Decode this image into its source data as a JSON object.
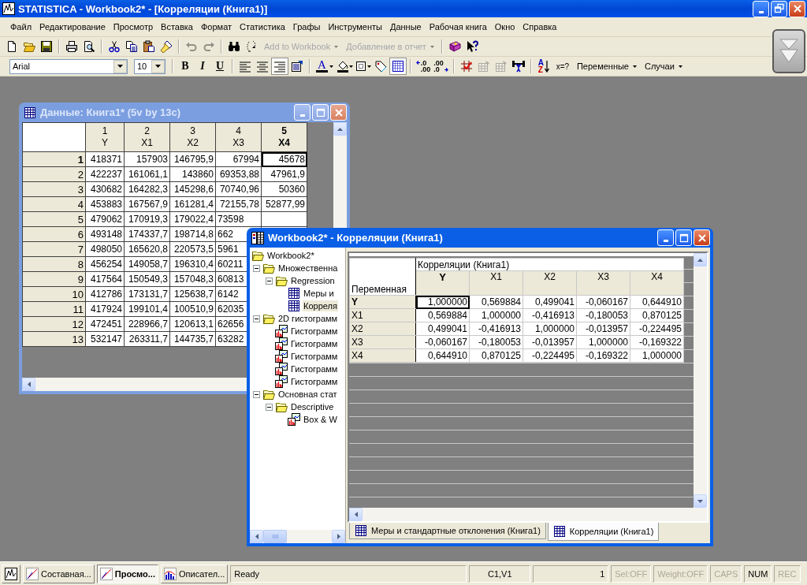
{
  "app_window": {
    "title": "STATISTICA - Workbook2* - [Корреляции (Книга1)]"
  },
  "menu": [
    "Файл",
    "Редактирование",
    "Просмотр",
    "Вставка",
    "Формат",
    "Статистика",
    "Графы",
    "Инструменты",
    "Данные",
    "Рабочая книга",
    "Окно",
    "Справка"
  ],
  "toolbar_standard": [
    {
      "kind": "new",
      "disabled": false
    },
    {
      "kind": "open",
      "disabled": false
    },
    {
      "kind": "save",
      "disabled": false
    },
    {
      "kind": "sep"
    },
    {
      "kind": "print",
      "disabled": false
    },
    {
      "kind": "preview",
      "disabled": false
    },
    {
      "kind": "sep"
    },
    {
      "kind": "cut",
      "disabled": false
    },
    {
      "kind": "copy",
      "disabled": false
    },
    {
      "kind": "paste",
      "disabled": false
    },
    {
      "kind": "painter",
      "disabled": false
    },
    {
      "kind": "sep"
    },
    {
      "kind": "undo",
      "disabled": true
    },
    {
      "kind": "redo",
      "disabled": true
    },
    {
      "kind": "sep"
    },
    {
      "kind": "find",
      "disabled": false
    },
    {
      "kind": "cases",
      "disabled": false
    },
    {
      "kind": "menu",
      "label": "Add to Workbook",
      "disabled": true
    },
    {
      "kind": "menu",
      "label": "Добавление в отчет",
      "disabled": true
    },
    {
      "kind": "sep"
    },
    {
      "kind": "book",
      "disabled": false
    },
    {
      "kind": "whatsthis",
      "disabled": false
    }
  ],
  "toolbar_format": {
    "font": {
      "value": "Arial"
    },
    "font_size": {
      "value": "10"
    },
    "buttons": [
      {
        "kind": "sep"
      },
      {
        "kind": "bold",
        "label": "B",
        "pressed": false,
        "disabled": false
      },
      {
        "kind": "italic",
        "label": "I",
        "pressed": false,
        "disabled": false
      },
      {
        "kind": "underline",
        "label": "U",
        "pressed": false,
        "disabled": false
      },
      {
        "kind": "sep"
      },
      {
        "kind": "align_left",
        "pressed": false,
        "disabled": false
      },
      {
        "kind": "align_center",
        "pressed": false,
        "disabled": false
      },
      {
        "kind": "align_right",
        "pressed": true,
        "disabled": false
      },
      {
        "kind": "props",
        "pressed": false,
        "disabled": false
      },
      {
        "kind": "sep"
      },
      {
        "kind": "font_color",
        "label": "A",
        "pressed": false,
        "disabled": false
      },
      {
        "kind": "fill",
        "pressed": false,
        "disabled": false
      },
      {
        "kind": "border",
        "pressed": false,
        "disabled": false
      },
      {
        "kind": "tag",
        "pressed": false,
        "disabled": false
      },
      {
        "kind": "grid",
        "pressed": true,
        "disabled": false
      },
      {
        "kind": "sep"
      },
      {
        "kind": "decimals_add",
        "lines": [
          ".0",
          ".00"
        ],
        "pressed": false,
        "disabled": false
      },
      {
        "kind": "decimals_remove",
        "lines": [
          ".00",
          ".0"
        ],
        "pressed": false,
        "disabled": false
      },
      {
        "kind": "sep"
      },
      {
        "kind": "mark",
        "pressed": false,
        "disabled": false
      },
      {
        "kind": "table_edit",
        "pressed": false,
        "disabled": true
      },
      {
        "kind": "table_edit",
        "pressed": false,
        "disabled": true
      },
      {
        "kind": "weight",
        "pressed": false,
        "disabled": false
      },
      {
        "kind": "sep"
      },
      {
        "kind": "sort",
        "letters": [
          "A",
          "Z"
        ],
        "pressed": false,
        "disabled": false
      },
      {
        "kind": "formula",
        "label": "x=?",
        "pressed": false,
        "disabled": false
      },
      {
        "kind": "menu",
        "label": "Переменные",
        "pressed": false,
        "disabled": false
      },
      {
        "kind": "menu",
        "label": "Случаи",
        "pressed": false,
        "disabled": false
      }
    ]
  },
  "data_window": {
    "title": "Данные: Книга1* (5v by 13c)",
    "active": false,
    "columns": [
      {
        "number": "1",
        "name": "Y",
        "selected": false
      },
      {
        "number": "2",
        "name": "X1",
        "selected": false
      },
      {
        "number": "3",
        "name": "X2",
        "selected": false
      },
      {
        "number": "4",
        "name": "X3",
        "selected": false
      },
      {
        "number": "5",
        "name": "X4",
        "selected": true
      }
    ],
    "rows": [
      {
        "label": "1",
        "selected": true,
        "cells": [
          "418371",
          "157903",
          "146795,9",
          "67994",
          "45678"
        ]
      },
      {
        "label": "2",
        "selected": false,
        "cells": [
          "422237",
          "161061,1",
          "143860",
          "69353,88",
          "47961,9"
        ]
      },
      {
        "label": "3",
        "selected": false,
        "cells": [
          "430682",
          "164282,3",
          "145298,6",
          "70740,96",
          "50360"
        ]
      },
      {
        "label": "4",
        "selected": false,
        "cells": [
          "453883",
          "167567,9",
          "161281,4",
          "72155,78",
          "52877,99"
        ]
      },
      {
        "label": "5",
        "selected": false,
        "cells": [
          "479062",
          "170919,3",
          "179022,4",
          "73598"
        ]
      },
      {
        "label": "6",
        "selected": false,
        "cells": [
          "493148",
          "174337,7",
          "198714,8",
          "662"
        ]
      },
      {
        "label": "7",
        "selected": false,
        "cells": [
          "498050",
          "165620,8",
          "220573,5",
          "5961"
        ]
      },
      {
        "label": "8",
        "selected": false,
        "cells": [
          "456254",
          "149058,7",
          "196310,4",
          "60211"
        ]
      },
      {
        "label": "9",
        "selected": false,
        "cells": [
          "417564",
          "150549,3",
          "157048,3",
          "60813"
        ]
      },
      {
        "label": "10",
        "selected": false,
        "cells": [
          "412786",
          "173131,7",
          "125638,7",
          "6142"
        ]
      },
      {
        "label": "11",
        "selected": false,
        "cells": [
          "417924",
          "199101,4",
          "100510,9",
          "62035"
        ]
      },
      {
        "label": "12",
        "selected": false,
        "cells": [
          "472451",
          "228966,7",
          "120613,1",
          "62656"
        ]
      },
      {
        "label": "13",
        "selected": false,
        "cells": [
          "532147",
          "263311,7",
          "144735,7",
          "63282"
        ]
      }
    ]
  },
  "workbook_window": {
    "title": "Workbook2* - Корреляции (Книга1)",
    "active": true,
    "tree": {
      "label": "Workbook2*",
      "kind": "folder",
      "selected": false,
      "children": [
        {
          "label": "Множественна",
          "kind": "folder",
          "expanded": true,
          "selected": false,
          "children": [
            {
              "label": "Regression",
              "kind": "folder",
              "expanded": true,
              "selected": false,
              "children": [
                {
                  "label": "Меры и",
                  "kind": "table",
                  "selected": false
                },
                {
                  "label": "Корреля",
                  "kind": "table",
                  "selected": true
                }
              ]
            }
          ]
        },
        {
          "label": "2D гистограмм",
          "kind": "folder",
          "expanded": true,
          "selected": false,
          "children": [
            {
              "label": "Гистограмм",
              "kind": "graph",
              "selected": false
            },
            {
              "label": "Гистограмм",
              "kind": "graph",
              "selected": false
            },
            {
              "label": "Гистограмм",
              "kind": "graph",
              "selected": false
            },
            {
              "label": "Гистограмм",
              "kind": "graph",
              "selected": false
            },
            {
              "label": "Гистограмм",
              "kind": "graph",
              "selected": false
            }
          ]
        },
        {
          "label": "Основная стат",
          "kind": "folder",
          "expanded": true,
          "selected": false,
          "children": [
            {
              "label": "Descriptive",
              "kind": "folder",
              "expanded": true,
              "selected": false,
              "children": [
                {
                  "label": "Box & W",
                  "kind": "graph",
                  "selected": false
                }
              ]
            }
          ]
        }
      ]
    },
    "table": {
      "title": "Корреляции (Книга1)",
      "row_header": "Переменная",
      "columns": [
        {
          "label": "Y",
          "selected": true
        },
        {
          "label": "X1",
          "selected": false
        },
        {
          "label": "X2",
          "selected": false
        },
        {
          "label": "X3",
          "selected": false
        },
        {
          "label": "X4",
          "selected": false
        }
      ],
      "rows": [
        {
          "label": "Y",
          "selected": true,
          "cells": [
            "1,000000",
            "0,569884",
            "0,499041",
            "-0,060167",
            "0,644910"
          ]
        },
        {
          "label": "X1",
          "selected": false,
          "cells": [
            "0,569884",
            "1,000000",
            "-0,416913",
            "-0,180053",
            "0,870125"
          ]
        },
        {
          "label": "X2",
          "selected": false,
          "cells": [
            "0,499041",
            "-0,416913",
            "1,000000",
            "-0,013957",
            "-0,224495"
          ]
        },
        {
          "label": "X3",
          "selected": false,
          "cells": [
            "-0,060167",
            "-0,180053",
            "-0,013957",
            "1,000000",
            "-0,169322"
          ]
        },
        {
          "label": "X4",
          "selected": false,
          "cells": [
            "0,644910",
            "0,870125",
            "-0,224495",
            "-0,169322",
            "1,000000"
          ]
        }
      ]
    },
    "tabs": [
      {
        "label": "Меры и стандартные отклонения (Книга1)",
        "selected": false
      },
      {
        "label": "Корреляции (Книга1)",
        "selected": true
      }
    ]
  },
  "status_bar": {
    "tasks": [
      {
        "label": "Составная...",
        "kind": "line",
        "selected": false
      },
      {
        "label": "Просмо...",
        "kind": "line",
        "selected": true
      },
      {
        "label": "Описател...",
        "kind": "bar",
        "selected": false
      }
    ],
    "message": "Ready",
    "cell": "C1,V1",
    "count": "1",
    "indicators": [
      {
        "label": "Sel:OFF",
        "on": false
      },
      {
        "label": "Weight:OFF",
        "on": false
      },
      {
        "label": "CAPS",
        "on": false
      },
      {
        "label": "NUM",
        "on": true
      },
      {
        "label": "REC",
        "on": false
      }
    ]
  }
}
